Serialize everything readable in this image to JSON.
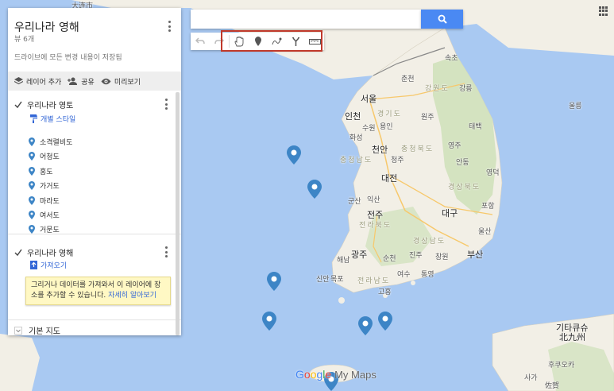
{
  "panel": {
    "title": "우리나라 영해",
    "views": "뷰 6개",
    "save_status": "드라이브에 모든 변경 내용이 저장됨",
    "actions": {
      "add_layer": "레이어 추가",
      "share": "공유",
      "preview": "미리보기"
    },
    "layer1": {
      "name": "우리나라 영토",
      "style_link": "개별 스타일",
      "features": [
        "소격렬비도",
        "어청도",
        "홍도",
        "가거도",
        "마라도",
        "여서도",
        "거문도"
      ]
    },
    "layer2": {
      "name": "우리나라 영해",
      "import_link": "가져오기",
      "tip_text": "그리거나 데이터를 가져와서 이 레이어에 장소를 추가할 수 있습니다.",
      "tip_link": "자세히 알아보기"
    },
    "base_map": "기본 지도"
  },
  "search": {
    "placeholder": ""
  },
  "toolbar": {
    "icons": [
      "undo-icon",
      "redo-icon",
      "hand-icon",
      "marker-icon",
      "draw-line-icon",
      "directions-icon",
      "ruler-icon"
    ]
  },
  "map_labels": {
    "seoul": "서울",
    "chuncheon": "춘천",
    "gangwon": "강원도",
    "gangneung": "강릉",
    "sokcho": "속초",
    "incheon": "인천",
    "suwon": "수원",
    "yongin": "용인",
    "gyeonggi": "경기도",
    "wonju": "원주",
    "cheonan": "천안",
    "chungnam": "충청남도",
    "cheongju": "청주",
    "chungbuk": "충청북도",
    "daejeon": "대전",
    "gyeongbuk": "경상북도",
    "yeongju": "영주",
    "andong": "안동",
    "yeongdeok": "영덕",
    "daegu": "대구",
    "jeonju": "전주",
    "jeonbuk": "전라북도",
    "pohang": "포항",
    "ulsan": "울산",
    "gwangju": "광주",
    "jeonnam": "전라남도",
    "gyeongnam": "경상남도",
    "busan": "부산",
    "jinju": "진주",
    "changwon": "창원",
    "mokpo": "목포",
    "suncheon": "순천",
    "taebaek": "태백",
    "hwaseong": "화성",
    "ulleung": "울릉",
    "kitakyushu_en": "기타큐슈",
    "kitakyushu_jp": "北九州",
    "fukuoka": "후쿠오카",
    "saga": "사가",
    "saga_jp": "佐賀",
    "dalian": "大连市",
    "mokpo_area": "신안",
    "yeosu": "여수",
    "tongyeong": "통영",
    "goheung": "고흥",
    "haenam": "해남",
    "gunsan": "군산",
    "iksan": "익산"
  },
  "logo": {
    "google": "Google",
    "mymaps": "My Maps"
  },
  "colors": {
    "sea": "#a9c9f2",
    "land": "#f2efe6",
    "mountain": "#cfe1b9",
    "pin": "#3d85c6",
    "accent": "#4a89f3",
    "highlight": "#c0392b"
  }
}
